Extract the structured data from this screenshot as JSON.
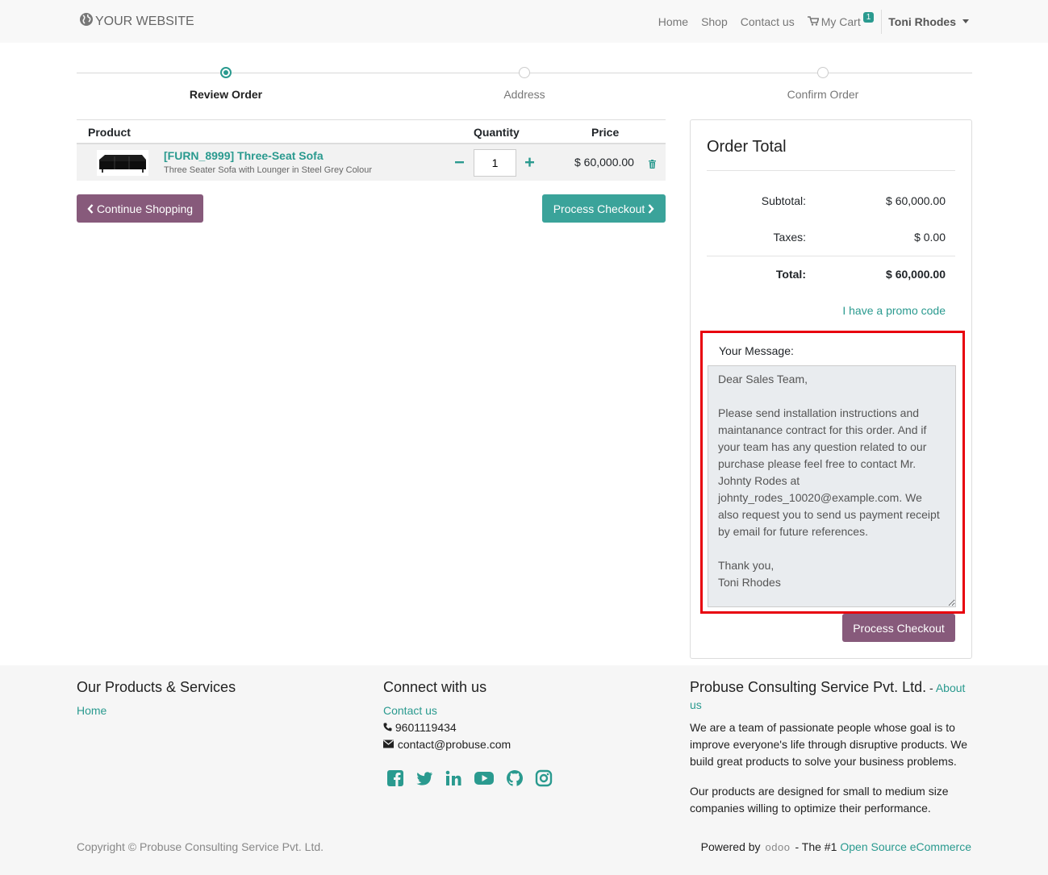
{
  "navbar": {
    "brand": "YOUR WEBSITE",
    "links": [
      "Home",
      "Shop",
      "Contact us"
    ],
    "cart_label": "My Cart",
    "cart_count": "1",
    "user": "Toni Rhodes"
  },
  "steps": [
    {
      "label": "Review Order",
      "active": true
    },
    {
      "label": "Address",
      "active": false
    },
    {
      "label": "Confirm Order",
      "active": false
    }
  ],
  "cart": {
    "headers": {
      "product": "Product",
      "quantity": "Quantity",
      "price": "Price"
    },
    "items": [
      {
        "name": "[FURN_8999] Three-Seat Sofa",
        "description": "Three Seater Sofa with Lounger in Steel Grey Colour",
        "quantity": "1",
        "price": "$ 60,000.00"
      }
    ],
    "continue_label": "Continue Shopping",
    "checkout_label": "Process Checkout"
  },
  "summary": {
    "title": "Order Total",
    "subtotal_label": "Subtotal:",
    "subtotal": "$ 60,000.00",
    "taxes_label": "Taxes:",
    "taxes": "$ 0.00",
    "total_label": "Total:",
    "total": "$ 60,000.00",
    "promo": "I have a promo code",
    "message_label": "Your Message:",
    "message": "Dear Sales Team,\n\nPlease send installation instructions and maintanance contract for this order. And if your team has any question related to our purchase please feel free to contact Mr. Johnty Rodes at johnty_rodes_10020@example.com. We also request you to send us payment receipt by email for future references.\n\nThank you,\nToni Rhodes",
    "checkout_label": "Process Checkout",
    "highlight_color": "#e8000d"
  },
  "footer": {
    "products": {
      "title": "Our Products & Services",
      "link": "Home"
    },
    "connect": {
      "title": "Connect with us",
      "contact_link": "Contact us",
      "phone": "9601119434",
      "email": "contact@probuse.com",
      "social_icons": [
        "facebook-icon",
        "twitter-icon",
        "linkedin-icon",
        "youtube-icon",
        "github-icon",
        "instagram-icon"
      ]
    },
    "company": {
      "title": "Probuse Consulting Service Pvt. Ltd.",
      "about_sep": " - ",
      "about_link": "About us",
      "para1": "We are a team of passionate people whose goal is to improve everyone's life through disruptive products. We build great products to solve your business problems.",
      "para2": "Our products are designed for small to medium size companies willing to optimize their performance."
    },
    "copyright": "Copyright © Probuse Consulting Service Pvt. Ltd.",
    "powered_by": "Powered by",
    "powered_brand": "odoo",
    "powered_mid": "- The #1",
    "powered_link": "Open Source eCommerce"
  },
  "colors": {
    "accent": "#2a9a8f",
    "primary": "#875a7b",
    "teal_button": "#3aa39a"
  }
}
